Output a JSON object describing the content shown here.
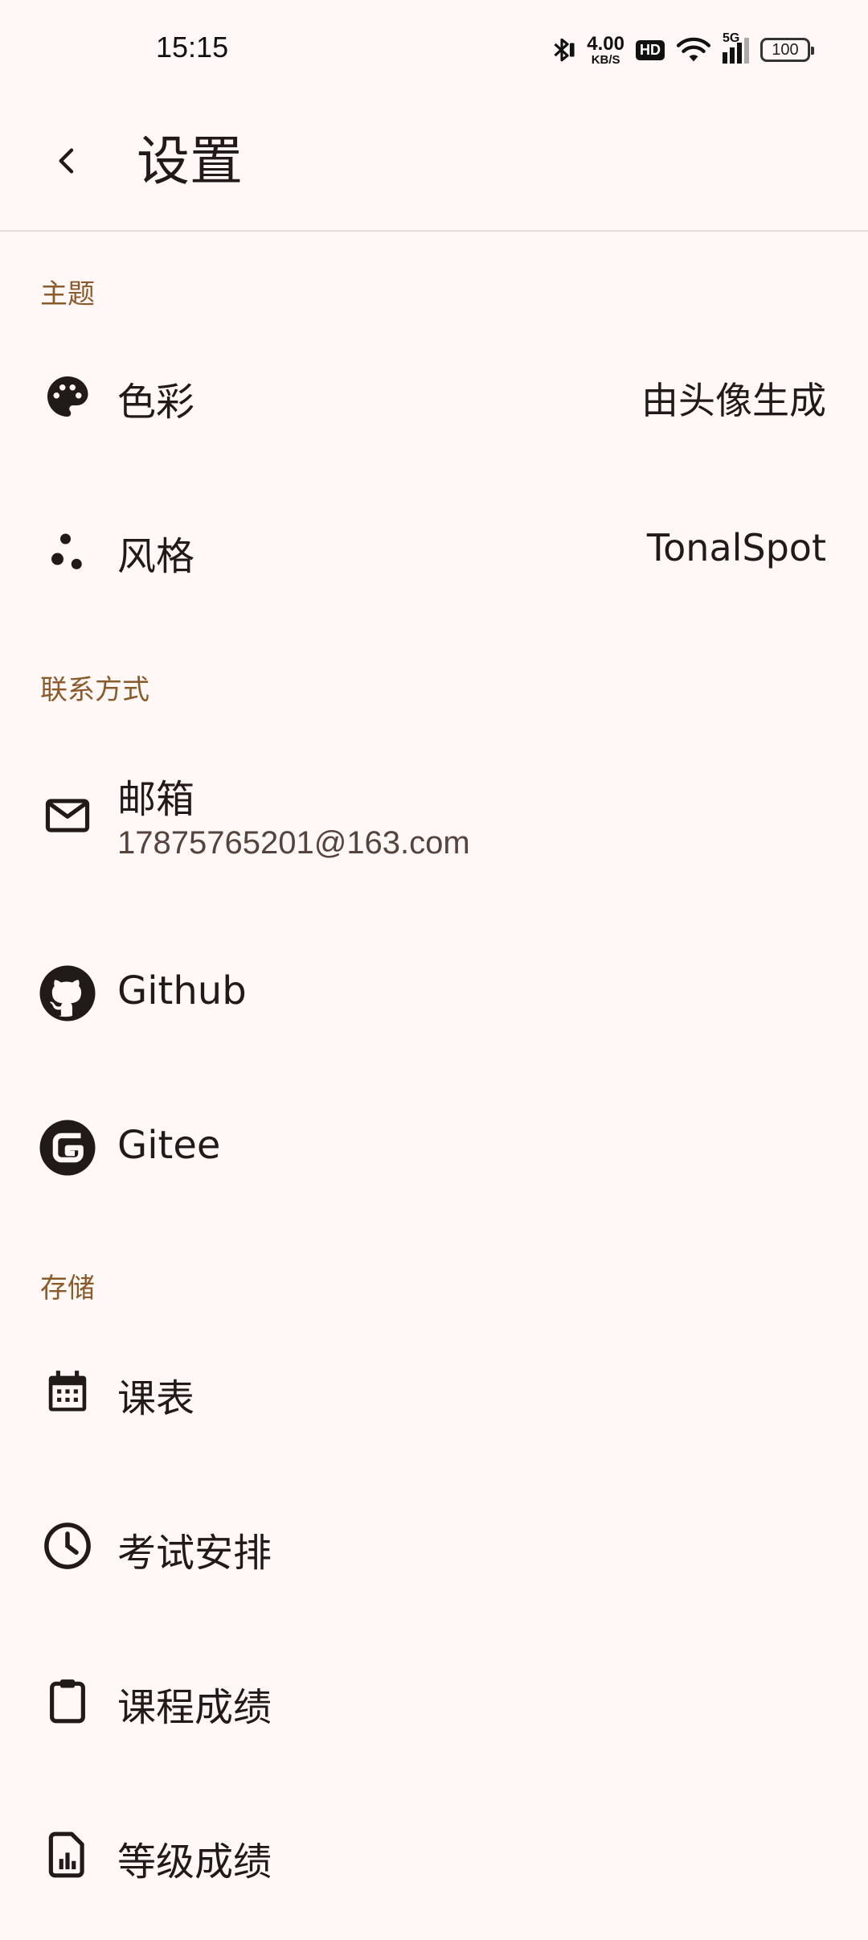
{
  "status_bar": {
    "time": "15:15",
    "net_speed_value": "4.00",
    "net_speed_unit": "KB/S",
    "hd_label": "HD",
    "network_type": "5G",
    "battery": "100",
    "icons": [
      "bluetooth-icon",
      "wifi-icon",
      "signal-icon",
      "battery-icon"
    ]
  },
  "app_bar": {
    "title": "设置",
    "back_icon": "arrow-back-icon"
  },
  "sections": {
    "theme": {
      "header": "主题",
      "color": {
        "label": "色彩",
        "value": "由头像生成",
        "icon": "palette-icon"
      },
      "style": {
        "label": "风格",
        "value": "TonalSpot",
        "icon": "bubbles-icon"
      }
    },
    "contact": {
      "header": "联系方式",
      "email": {
        "label": "邮箱",
        "value": "17875765201@163.com",
        "icon": "mail-icon"
      },
      "github": {
        "label": "Github",
        "icon": "github-icon"
      },
      "gitee": {
        "label": "Gitee",
        "icon": "gitee-icon"
      }
    },
    "storage": {
      "header": "存储",
      "timetable": {
        "label": "课表",
        "icon": "calendar-icon"
      },
      "exams": {
        "label": "考试安排",
        "icon": "clock-icon"
      },
      "course_grades": {
        "label": "课程成绩",
        "icon": "clipboard-icon"
      },
      "level_grades": {
        "label": "等级成绩",
        "icon": "report-icon"
      }
    }
  },
  "colors": {
    "background": "#fff8f6",
    "section_header": "#8b5a2b",
    "text": "#201a18"
  }
}
